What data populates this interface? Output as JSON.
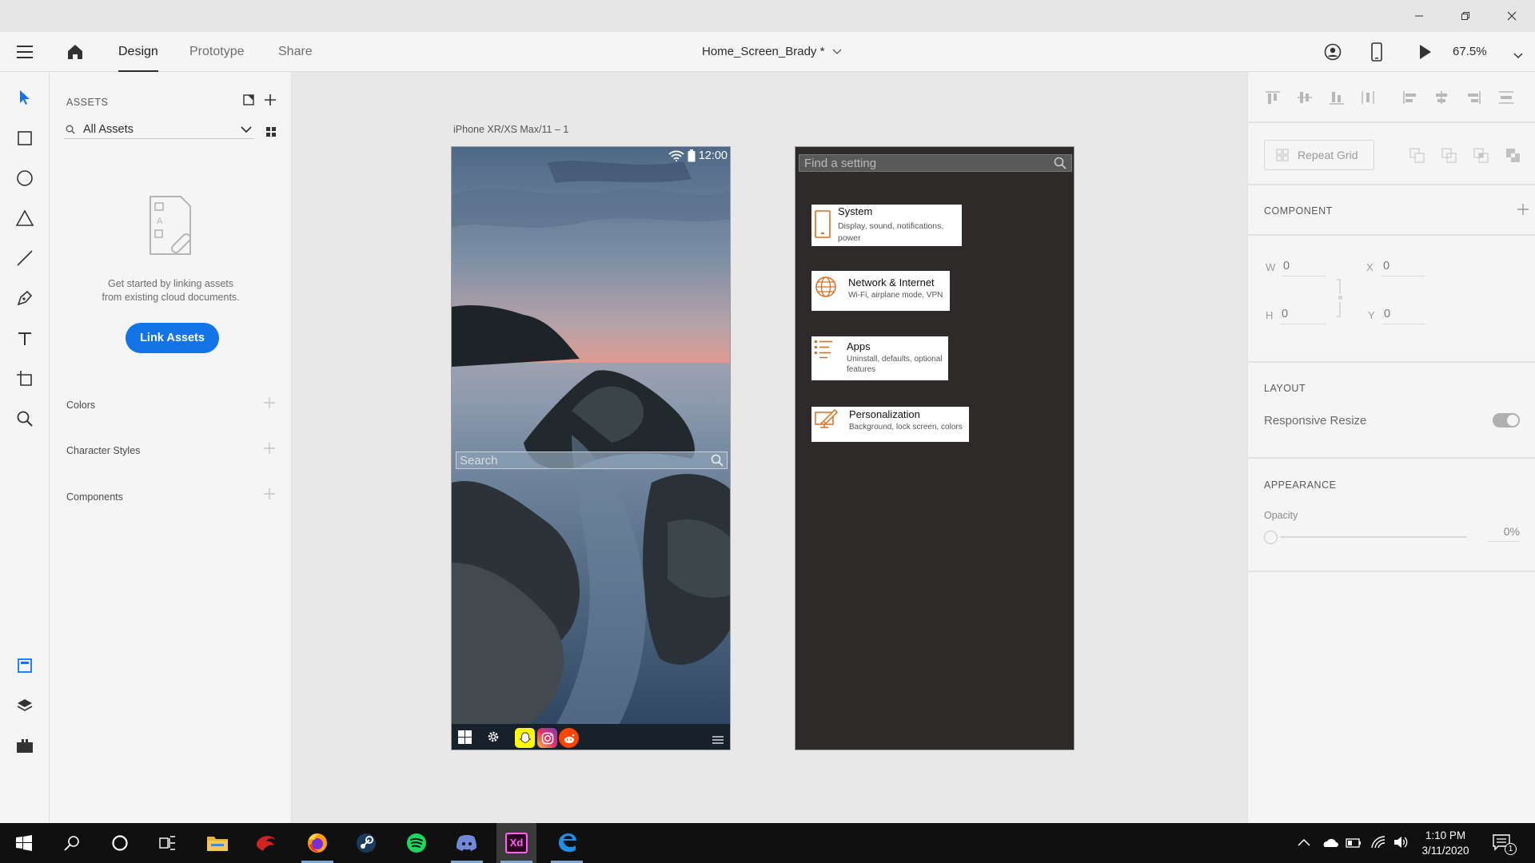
{
  "app": {
    "doc_title": "Home_Screen_Brady *",
    "tabs": [
      "Design",
      "Prototype",
      "Share"
    ],
    "active_tab": "Design",
    "zoom": "67.5%"
  },
  "assets": {
    "heading": "ASSETS",
    "filter_label": "All Assets",
    "empty_message_line1": "Get started by linking assets",
    "empty_message_line2": "from existing cloud documents.",
    "link_button": "Link Assets",
    "sections": [
      "Colors",
      "Character Styles",
      "Components"
    ]
  },
  "artboard1": {
    "label": "iPhone XR/XS Max/11 – 1",
    "time": "12:00",
    "search_placeholder": "Search"
  },
  "artboard2": {
    "search_placeholder": "Find a setting",
    "items": [
      {
        "title": "System",
        "subtitle": "Display, sound, notifications, power",
        "icon": "phone-icon"
      },
      {
        "title": "Network & Internet",
        "subtitle": "Wi-Fi, airplane mode, VPN",
        "icon": "globe-icon"
      },
      {
        "title": "Apps",
        "subtitle": "Uninstall, defaults, optional features",
        "icon": "apps-list-icon"
      },
      {
        "title": "Personalization",
        "subtitle": "Background, lock screen, colors",
        "icon": "paint-icon"
      }
    ]
  },
  "properties": {
    "repeat_grid": "Repeat Grid",
    "component_heading": "COMPONENT",
    "w_label": "W",
    "w_value": "0",
    "h_label": "H",
    "h_value": "0",
    "x_label": "X",
    "x_value": "0",
    "y_label": "Y",
    "y_value": "0",
    "layout_heading": "LAYOUT",
    "responsive_resize": "Responsive Resize",
    "appearance_heading": "APPEARANCE",
    "opacity_label": "Opacity",
    "opacity_value": "0%"
  },
  "taskbar": {
    "time": "1:10 PM",
    "date": "3/11/2020",
    "notification_count": "1"
  },
  "colors": {
    "accent_blue": "#1473e6",
    "orange_icon": "#d86e1f",
    "settings_bg": "#2d2a29"
  }
}
